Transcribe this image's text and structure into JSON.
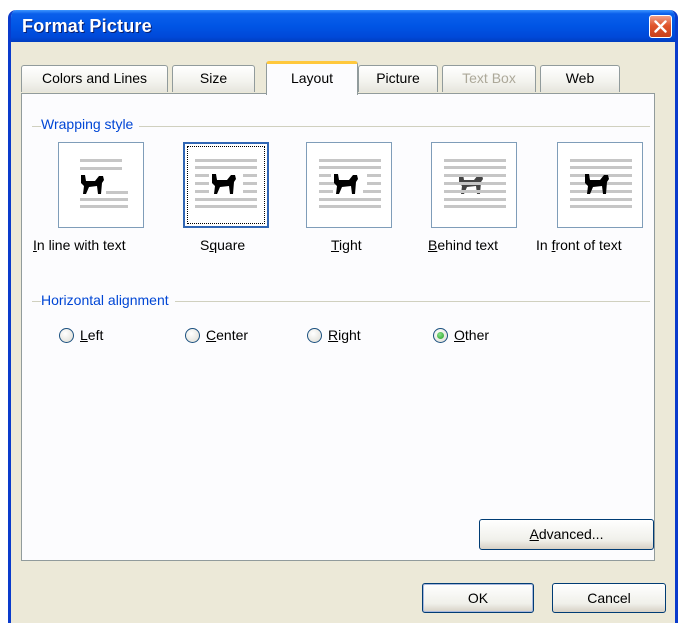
{
  "window": {
    "title": "Format Picture",
    "close_icon": "close-icon"
  },
  "tabs": [
    {
      "label": "Colors and Lines",
      "state": "normal"
    },
    {
      "label": "Size",
      "state": "normal"
    },
    {
      "label": "Layout",
      "state": "active"
    },
    {
      "label": "Picture",
      "state": "normal"
    },
    {
      "label": "Text Box",
      "state": "disabled"
    },
    {
      "label": "Web",
      "state": "normal"
    }
  ],
  "wrapping": {
    "group_label": "Wrapping style",
    "selected": "Square",
    "options": [
      {
        "label": "In line with text",
        "mnemonic": "I",
        "rest": "n line with text",
        "icon": "wrap-inline-icon"
      },
      {
        "label": "Square",
        "mnemonic": "q",
        "pre": "S",
        "rest": "uare",
        "icon": "wrap-square-icon"
      },
      {
        "label": "Tight",
        "mnemonic": "T",
        "rest": "ight",
        "icon": "wrap-tight-icon"
      },
      {
        "label": "Behind text",
        "mnemonic": "B",
        "rest": "ehind text",
        "icon": "wrap-behind-icon"
      },
      {
        "label": "In front of text",
        "pre": "In ",
        "mnemonic": "f",
        "rest": "ront of text",
        "icon": "wrap-front-icon"
      }
    ]
  },
  "alignment": {
    "group_label": "Horizontal alignment",
    "selected": "Other",
    "options": [
      {
        "label": "Left",
        "mnemonic": "L",
        "rest": "eft"
      },
      {
        "label": "Center",
        "mnemonic": "C",
        "rest": "enter"
      },
      {
        "label": "Right",
        "mnemonic": "R",
        "rest": "ight"
      },
      {
        "label": "Other",
        "mnemonic": "O",
        "rest": "ther"
      }
    ]
  },
  "buttons": {
    "advanced": {
      "mnemonic": "A",
      "rest": "dvanced..."
    },
    "ok": "OK",
    "cancel": "Cancel"
  },
  "colors": {
    "title_bar": "#0055E5",
    "group_label": "#0046D5",
    "dialog_bg": "#ECE9D8",
    "active_tab_accent": "#FFC83C"
  }
}
